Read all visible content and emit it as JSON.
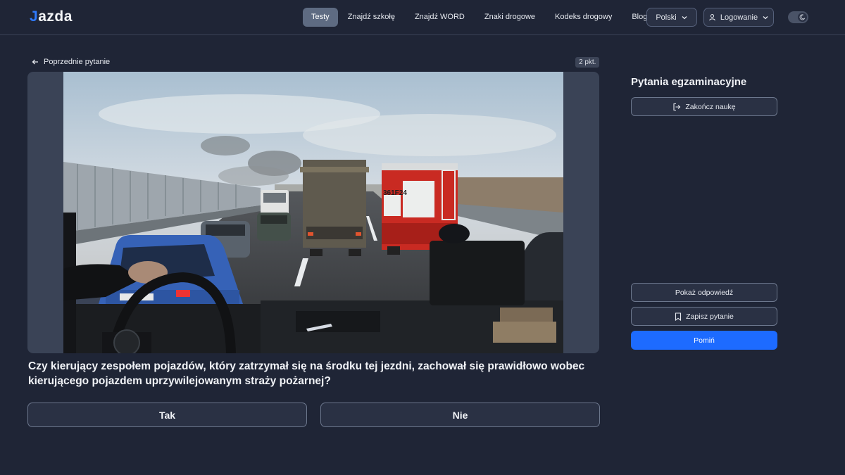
{
  "header": {
    "logo": "Jazda",
    "nav": [
      "Testy",
      "Znajdź szkołę",
      "Znajdź WORD",
      "Znaki drogowe",
      "Kodeks drogowy",
      "Blog"
    ],
    "active_nav": "Testy",
    "language": "Polski",
    "login": "Logowanie"
  },
  "question": {
    "prev_label": "Poprzednie pytanie",
    "points": "2 pkt.",
    "text": "Czy kierujący zespołem pojazdów, który zatrzymał się na środku tej jezdni, zachował się prawidłowo wobec kierującego pojazdem uprzywilejowanym straży pożarnej?",
    "answers": [
      "Tak",
      "Nie"
    ],
    "fire_truck_plate": "361F24"
  },
  "sidebar": {
    "title": "Pytania egzaminacyjne",
    "finish": "Zakończ naukę",
    "show_answer": "Pokaż odpowiedź",
    "save_question": "Zapisz pytanie",
    "skip": "Pomiń"
  },
  "colors": {
    "background": "#1f2536",
    "accent": "#1d6bff",
    "active_nav": "#5e6b82"
  }
}
